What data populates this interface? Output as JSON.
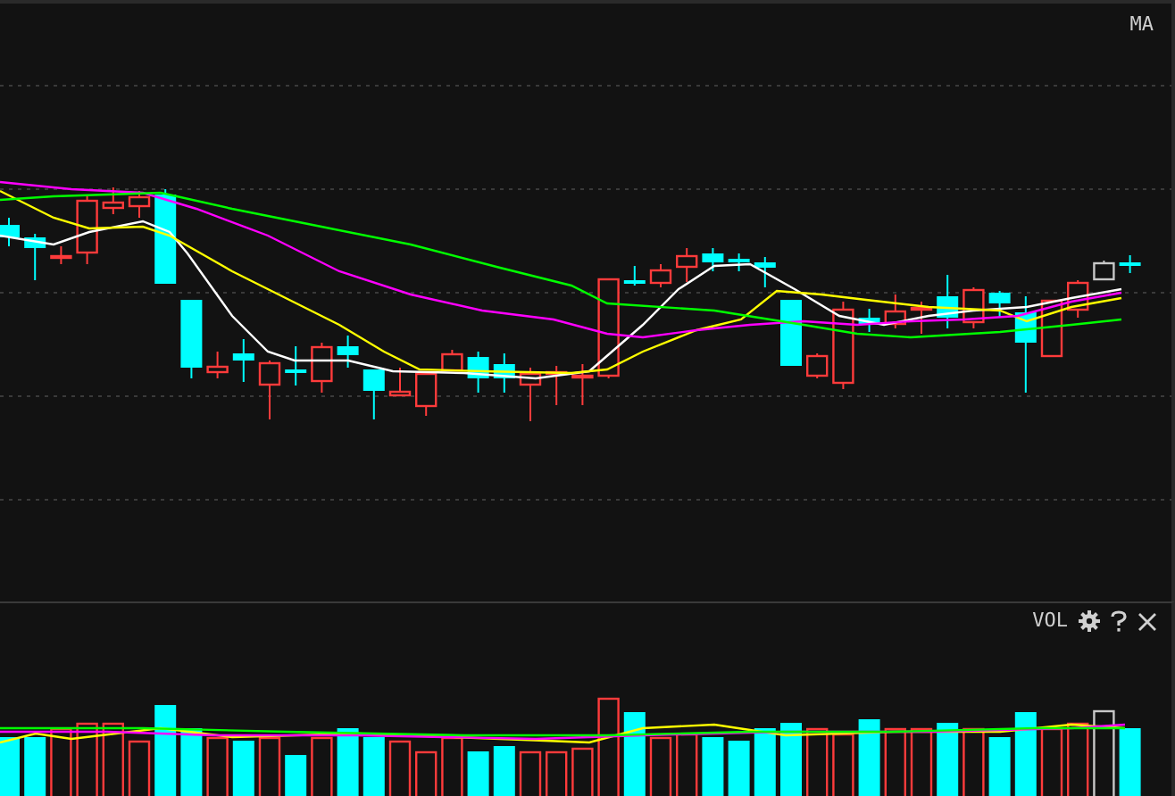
{
  "main_panel": {
    "indicator_label": "MA"
  },
  "volume_panel": {
    "indicator_label": "VOL"
  }
}
